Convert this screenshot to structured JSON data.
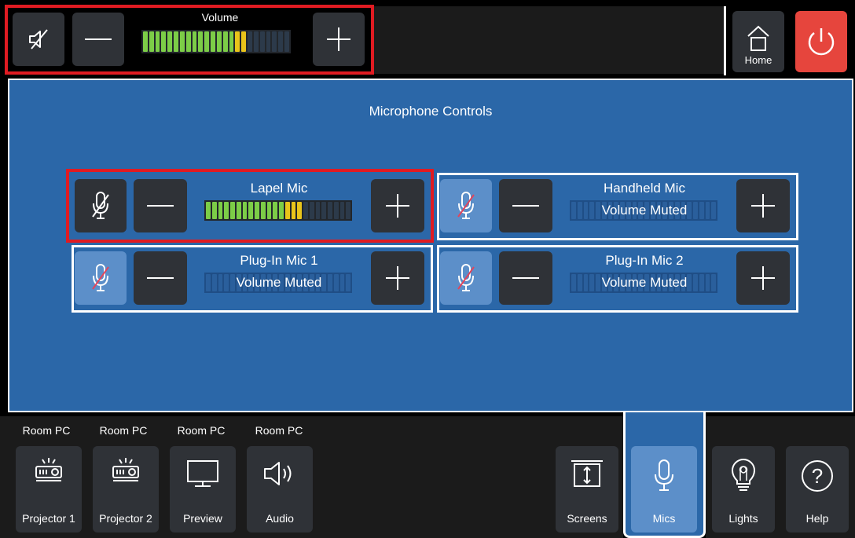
{
  "top": {
    "volume_label": "Volume",
    "volume_level": 0.7,
    "home_label": "Home"
  },
  "main": {
    "title": "Microphone Controls",
    "mics": [
      {
        "name": "Lapel Mic",
        "status": "",
        "muted": false,
        "level": 0.65
      },
      {
        "name": "Handheld Mic",
        "status": "Volume Muted",
        "muted": true,
        "level": 0
      },
      {
        "name": "Plug-In Mic 1",
        "status": "Volume Muted",
        "muted": true,
        "level": 0
      },
      {
        "name": "Plug-In Mic 2",
        "status": "Volume Muted",
        "muted": true,
        "level": 0
      }
    ]
  },
  "bottom": {
    "sources": [
      {
        "group": "Room PC",
        "label": "Projector 1",
        "icon": "projector-icon"
      },
      {
        "group": "Room PC",
        "label": "Projector 2",
        "icon": "projector-icon"
      },
      {
        "group": "Room PC",
        "label": "Preview",
        "icon": "monitor-icon"
      },
      {
        "group": "Room PC",
        "label": "Audio",
        "icon": "speaker-icon"
      }
    ],
    "nav": [
      {
        "label": "Screens",
        "icon": "screen-icon"
      },
      {
        "label": "Mics",
        "icon": "microphone-icon",
        "active": true
      },
      {
        "label": "Lights",
        "icon": "lightbulb-icon"
      },
      {
        "label": "Help",
        "icon": "help-icon"
      }
    ]
  },
  "colors": {
    "accent_blue": "#2b67a8",
    "highlight_red": "#e01b22",
    "power_red": "#e6453d",
    "meter_green": "#7ccd47",
    "meter_yellow": "#e9c41a"
  }
}
